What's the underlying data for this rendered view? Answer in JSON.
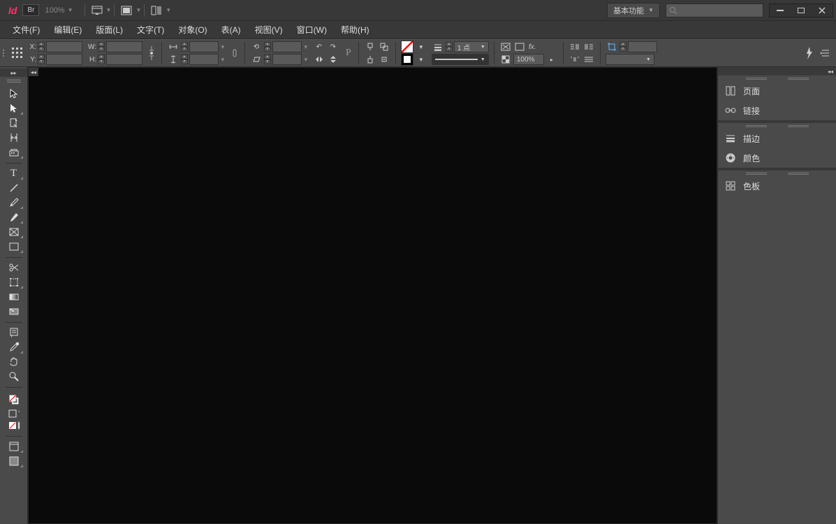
{
  "titlebar": {
    "br_label": "Br",
    "zoom": "100%",
    "workspace": "基本功能"
  },
  "menu": {
    "items": [
      "文件(F)",
      "编辑(E)",
      "版面(L)",
      "文字(T)",
      "对象(O)",
      "表(A)",
      "视图(V)",
      "窗口(W)",
      "帮助(H)"
    ]
  },
  "control": {
    "x_label": "X:",
    "y_label": "Y:",
    "w_label": "W:",
    "h_label": "H:",
    "stroke_weight": "1 点",
    "opacity": "100%",
    "fx_label": "fx."
  },
  "panels": {
    "items": [
      "页面",
      "链接",
      "描边",
      "颜色",
      "色板"
    ]
  }
}
